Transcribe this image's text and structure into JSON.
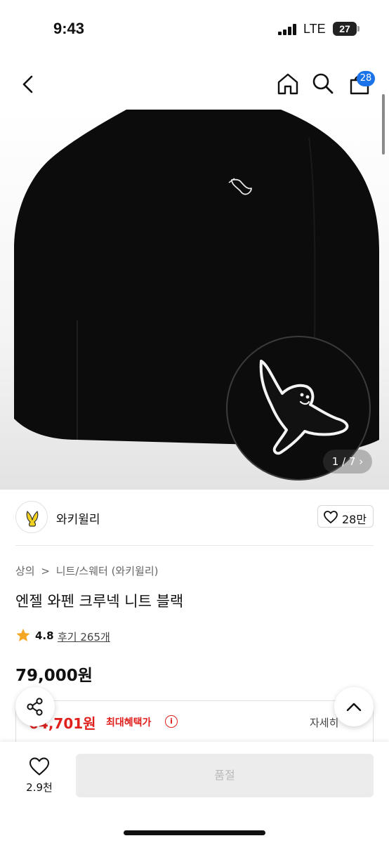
{
  "status": {
    "time": "9:43",
    "network": "LTE",
    "battery": "27"
  },
  "nav": {
    "back_icon": "chevron-left-icon",
    "home_icon": "home-icon",
    "search_icon": "search-icon",
    "cart_icon": "cart-icon",
    "cart_count": "28"
  },
  "hero": {
    "page_indicator": "1 / 7 ›",
    "image_current": 1,
    "image_total": 7
  },
  "brand": {
    "name": "와키윌리",
    "like_count": "28만",
    "like_icon": "heart-outline-icon"
  },
  "breadcrumb": {
    "level1": "상의",
    "separator": ">",
    "level2": "니트/스웨터 (와키윌리)"
  },
  "product": {
    "title": "엔젤 와펜 크루넥 니트 블랙",
    "rating": "4.8",
    "reviews_label": "후기 265개",
    "price": "79,000원"
  },
  "benefit": {
    "price": "64,701원",
    "label": "최대혜택가",
    "info_icon": "i",
    "detail": "자세히"
  },
  "bottom": {
    "wish_count": "2.9천",
    "soldout_label": "품절"
  },
  "colors": {
    "accent_red": "#e0201d",
    "badge_blue": "#1a73e8",
    "sweater_black": "#0c0c0c"
  }
}
